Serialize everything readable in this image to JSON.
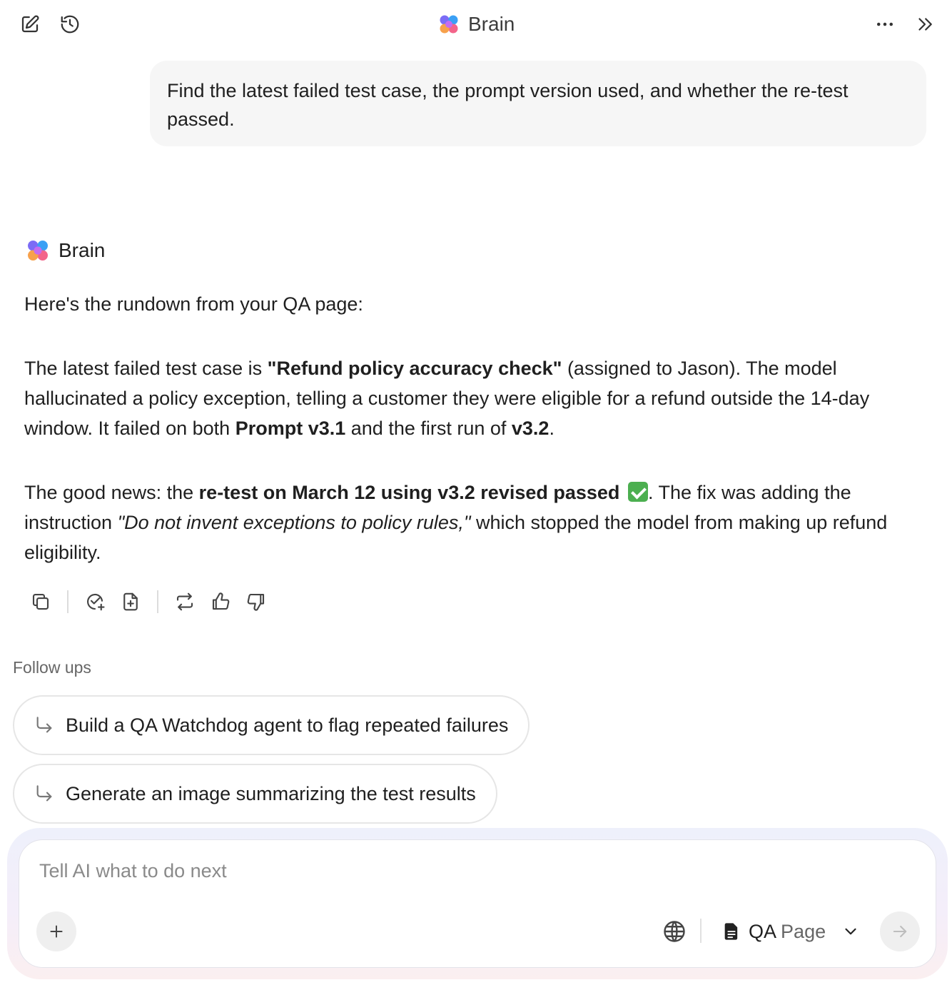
{
  "header": {
    "title": "Brain",
    "icons": [
      "new-chat-icon",
      "history-icon",
      "more-icon",
      "collapse-panel-icon"
    ]
  },
  "user_message": {
    "text": "Find the latest failed test case, the prompt version used, and whether the re-test passed."
  },
  "assistant": {
    "name": "Brain",
    "intro": "Here's the rundown from your QA page:",
    "p2": {
      "a": "The latest failed test case is ",
      "b_case": "\"Refund policy accuracy check\"",
      "c": " (assigned to Jason). The model hallucinated a policy exception, telling a customer they were eligible for a refund outside the 14-day window. It failed on both ",
      "b_prompt": "Prompt v3.1",
      "d": " and the first run of ",
      "b_version": "v3.2",
      "e": "."
    },
    "p3": {
      "a": "The good news: the ",
      "b_retest": "re-test on March 12 using v3.2 revised passed",
      "c": ". The fix was adding the instruction ",
      "i_quote": "\"Do not invent exceptions to policy rules,\"",
      "d": " which stopped the model from making up refund eligibility."
    },
    "action_icons": [
      "copy-icon",
      "create-task-icon",
      "add-to-doc-icon",
      "regenerate-icon",
      "thumbs-up-icon",
      "thumbs-down-icon"
    ]
  },
  "followups": {
    "label": "Follow ups",
    "items": [
      "Build a QA Watchdog agent to flag repeated failures",
      "Generate an image summarizing the test results"
    ]
  },
  "composer": {
    "placeholder": "Tell AI what to do next",
    "context_prefix": "QA",
    "context_suffix": "Page"
  },
  "colors": {
    "user_bubble": "#f6f6f6",
    "check": "#4caf50",
    "composer_glow_top": "#eef0fb",
    "composer_glow_bottom": "#fbeff0"
  }
}
